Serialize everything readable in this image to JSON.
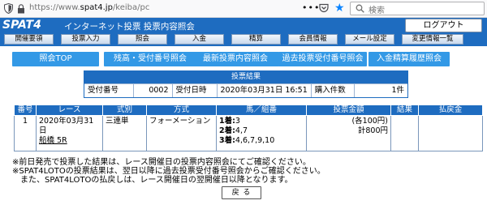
{
  "browser": {
    "url_prefix": "https://www.",
    "url_domain": "spat4.jp",
    "url_path": "/keiba/pc",
    "more_label": "•••",
    "search_placeholder": "検索"
  },
  "header": {
    "logo_text": "SPAT",
    "logo_four": "4",
    "site_title": "インターネット投票  投票内容照会",
    "logout_label": "ログアウト"
  },
  "nav": {
    "items": [
      "開催要領",
      "投票入力",
      "照会",
      "入金",
      "精算",
      "会員情報",
      "メール設定",
      "変更情報一覧"
    ]
  },
  "buttons": [
    "照会TOP",
    "残高・受付番号照会",
    "最新投票内容照会",
    "過去投票受付番号照会",
    "入金精算履歴照会"
  ],
  "summary": {
    "title": "投票結果",
    "receipt_label": "受付番号",
    "receipt_value": "0002",
    "datetime_label": "受付日時",
    "datetime_value": "2020年03月31日 16:51",
    "count_label": "購入件数",
    "count_value": "1件"
  },
  "table": {
    "headers": [
      "番号",
      "レース",
      "式別",
      "方式",
      "馬／組番",
      "投票金額",
      "結果",
      "払戻金"
    ],
    "rows": [
      {
        "number": "1",
        "race_date": "2020年03月31日",
        "race_venue": "船橋 5R",
        "bet_type": "三連単",
        "method": "フォーメーション",
        "horse1_label": "1着:",
        "horse1_value": "3",
        "horse2_label": "2着:",
        "horse2_value": "4,7",
        "horse3_label": "3着:",
        "horse3_value": "4,6,7,9,10",
        "amount_each": "(各100円)",
        "amount_total": "計800円",
        "result": "",
        "payout": ""
      }
    ]
  },
  "notes": [
    "※前日発売で投票した結果は、レース開催日の投票内容照会にてご確認ください。",
    "※SPAT4LOTOの投票結果は、翌日以降に過去投票受付番号照会からご確認ください。",
    "　また、SPAT4LOTOの払戻しは、レース開催日の翌開催日以降となります。"
  ],
  "back_label": "戻 る",
  "colors": {
    "header_blue": "#1e6cc0",
    "button_blue": "#3399e6",
    "star_blue": "#0a84ff"
  }
}
